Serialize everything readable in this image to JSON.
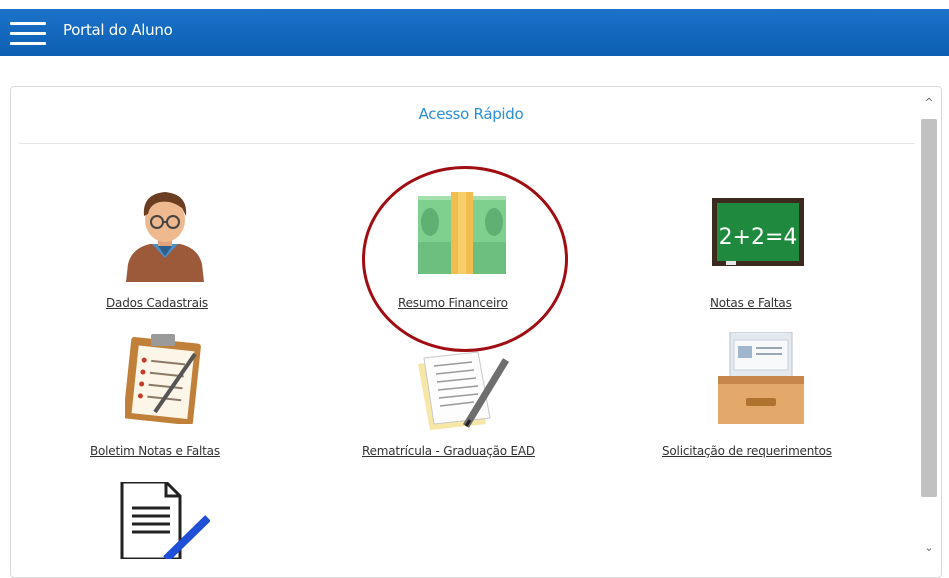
{
  "header": {
    "title": "Portal do Aluno",
    "menu_icon": "hamburger-menu-icon"
  },
  "panel": {
    "title": "Acesso Rápido"
  },
  "tiles": [
    {
      "label": "Dados Cadastrais",
      "icon": "student-avatar-icon"
    },
    {
      "label": "Resumo Financeiro",
      "icon": "money-stack-icon"
    },
    {
      "label": "Notas e Faltas",
      "icon": "chalkboard-icon"
    },
    {
      "label": "Boletim Notas e Faltas",
      "icon": "clipboard-icon"
    },
    {
      "label": "Rematrícula - Graduação EAD",
      "icon": "document-pen-icon"
    },
    {
      "label": "Solicitação de requerimentos",
      "icon": "file-drawer-icon"
    },
    {
      "label": "",
      "icon": "document-edit-icon"
    }
  ],
  "chalkboard_text": "2+2=4",
  "colors": {
    "header": "#0d5fb3",
    "accent": "#2a8fd6",
    "highlight": "#a00d12"
  }
}
